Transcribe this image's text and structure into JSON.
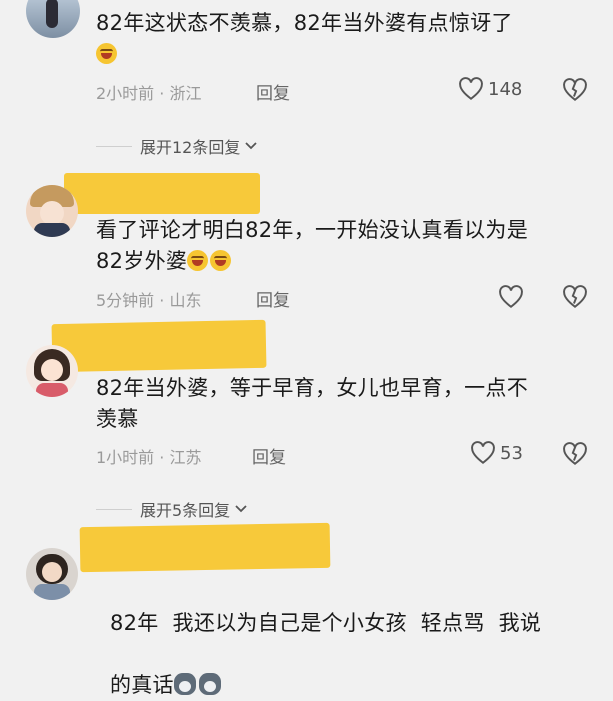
{
  "comments": [
    {
      "text": "82年这状态不羡慕，82年当外婆有点惊讶了",
      "emojis": [
        "laughing-crying-emoji"
      ],
      "time": "2小时前",
      "location": "浙江",
      "reply": "回复",
      "likes": "148"
    },
    {
      "text": "看了评论才明白82年，一开始没认真看以为是82岁外婆",
      "emojis": [
        "laughing-crying-emoji",
        "laughing-crying-emoji"
      ],
      "time": "5分钟前",
      "location": "山东",
      "reply": "回复",
      "likes": ""
    },
    {
      "text": "82年当外婆，等于早育，女儿也早育，一点不羡慕",
      "emojis": [],
      "time": "1小时前",
      "location": "江苏",
      "reply": "回复",
      "likes": "53"
    },
    {
      "text": "82年  我还以为自己是个小女孩  轻点骂  我说的真话",
      "emojis": [
        "husky-emoji",
        "husky-emoji"
      ],
      "time": "",
      "location": "",
      "reply": "",
      "likes": ""
    }
  ],
  "lines": {
    "c1l1": "82年这状态不羡慕，82年当外婆有点惊讶了",
    "c2l1": "看了评论才明白82年，一开始没认真看以为是",
    "c2l2": "82岁外婆",
    "c3l1": "82年当外婆，等于早育，女儿也早育，一点不",
    "c3l2": "羡慕",
    "c4l1": "82年  我还以为自己是个小女孩  轻点骂  我说",
    "c4l2": "的真话"
  },
  "meta": {
    "c1": "2小时前 · 浙江",
    "c2": "5分钟前 · 山东",
    "c3": "1小时前 · 江苏"
  },
  "expand": {
    "first": "展开12条回复",
    "second": "展开5条回复"
  },
  "colors": {
    "background": "#f1f1f1",
    "redaction": "#f7c93a",
    "meta_text": "#9a9a9a"
  }
}
